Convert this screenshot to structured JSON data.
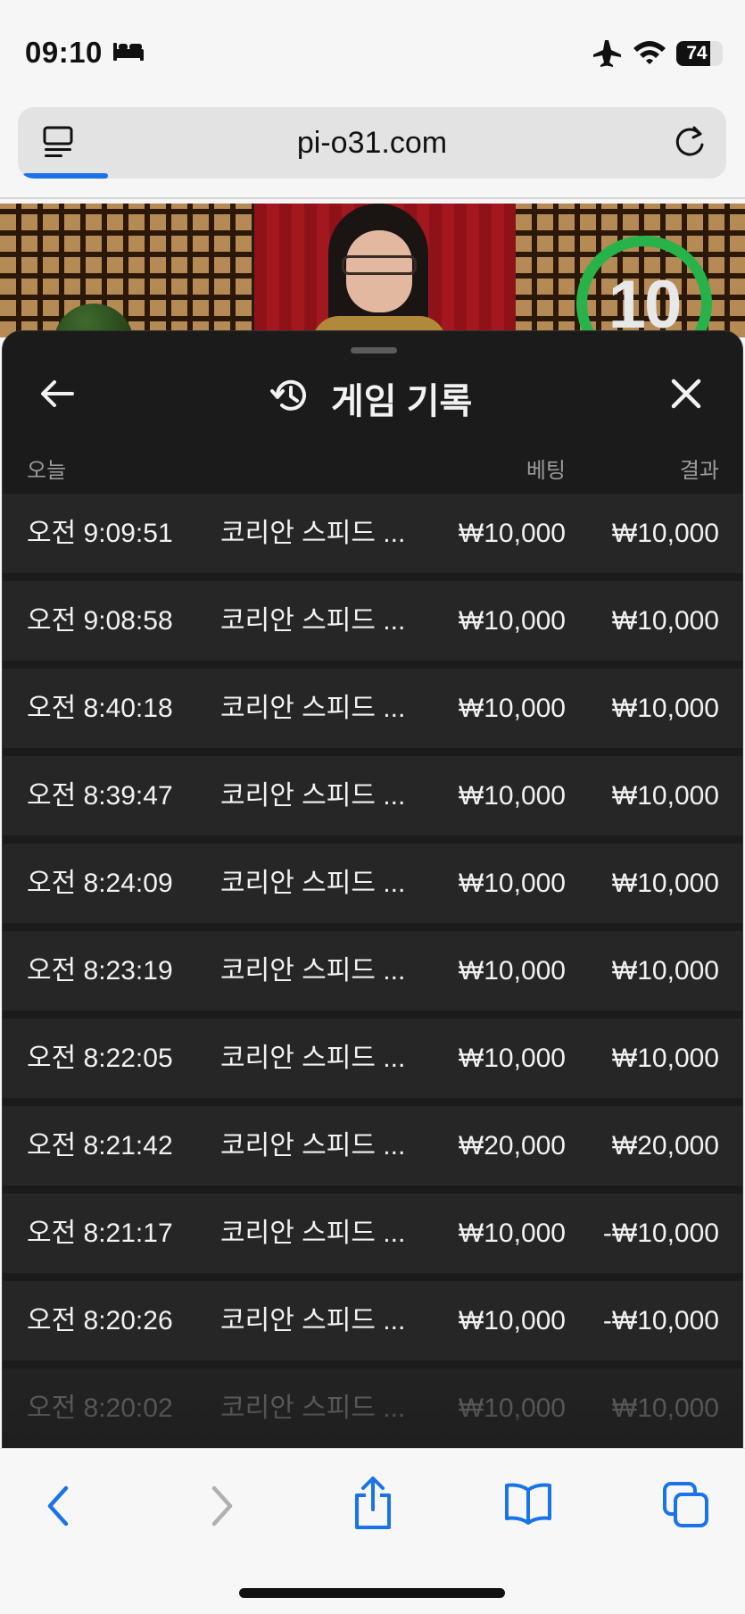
{
  "status_bar": {
    "time": "09:10",
    "battery": "74",
    "battery_level": 0.74
  },
  "address_bar": {
    "url": "pi-o31.com",
    "load_progress": 0.12
  },
  "video": {
    "countdown": "10"
  },
  "sheet": {
    "title": "게임 기록",
    "columns": {
      "today": "오늘",
      "bet": "베팅",
      "result": "결과"
    },
    "rows": [
      {
        "time": "오전 9:09:51",
        "game": "코리안 스피드 ...",
        "bet": "₩10,000",
        "result": "₩10,000"
      },
      {
        "time": "오전 9:08:58",
        "game": "코리안 스피드 ...",
        "bet": "₩10,000",
        "result": "₩10,000"
      },
      {
        "time": "오전 8:40:18",
        "game": "코리안 스피드 ...",
        "bet": "₩10,000",
        "result": "₩10,000"
      },
      {
        "time": "오전 8:39:47",
        "game": "코리안 스피드 ...",
        "bet": "₩10,000",
        "result": "₩10,000"
      },
      {
        "time": "오전 8:24:09",
        "game": "코리안 스피드 ...",
        "bet": "₩10,000",
        "result": "₩10,000"
      },
      {
        "time": "오전 8:23:19",
        "game": "코리안 스피드 ...",
        "bet": "₩10,000",
        "result": "₩10,000"
      },
      {
        "time": "오전 8:22:05",
        "game": "코리안 스피드 ...",
        "bet": "₩10,000",
        "result": "₩10,000"
      },
      {
        "time": "오전 8:21:42",
        "game": "코리안 스피드 ...",
        "bet": "₩20,000",
        "result": "₩20,000"
      },
      {
        "time": "오전 8:21:17",
        "game": "코리안 스피드 ...",
        "bet": "₩10,000",
        "result": "-₩10,000"
      },
      {
        "time": "오전 8:20:26",
        "game": "코리안 스피드 ...",
        "bet": "₩10,000",
        "result": "-₩10,000"
      },
      {
        "time": "오전 8:20:02",
        "game": "코리안 스피드 ...",
        "bet": "₩10,000",
        "result": "₩10,000"
      }
    ]
  },
  "colors": {
    "accent": "#1a73e8",
    "timer_ring": "#27b24a",
    "sheet_bg": "#1b1b1b",
    "row_bg": "#262626"
  },
  "icons": {
    "bed": "bed-icon",
    "airplane": "airplane-icon",
    "wifi": "wifi-icon",
    "reader": "reader-icon",
    "reload": "reload-icon",
    "back": "back-arrow-icon",
    "history": "history-icon",
    "close": "close-icon",
    "toolbar_back": "chevron-left-icon",
    "toolbar_forward": "chevron-right-icon",
    "share": "share-icon",
    "bookmarks": "book-icon",
    "tabs": "tabs-icon"
  }
}
